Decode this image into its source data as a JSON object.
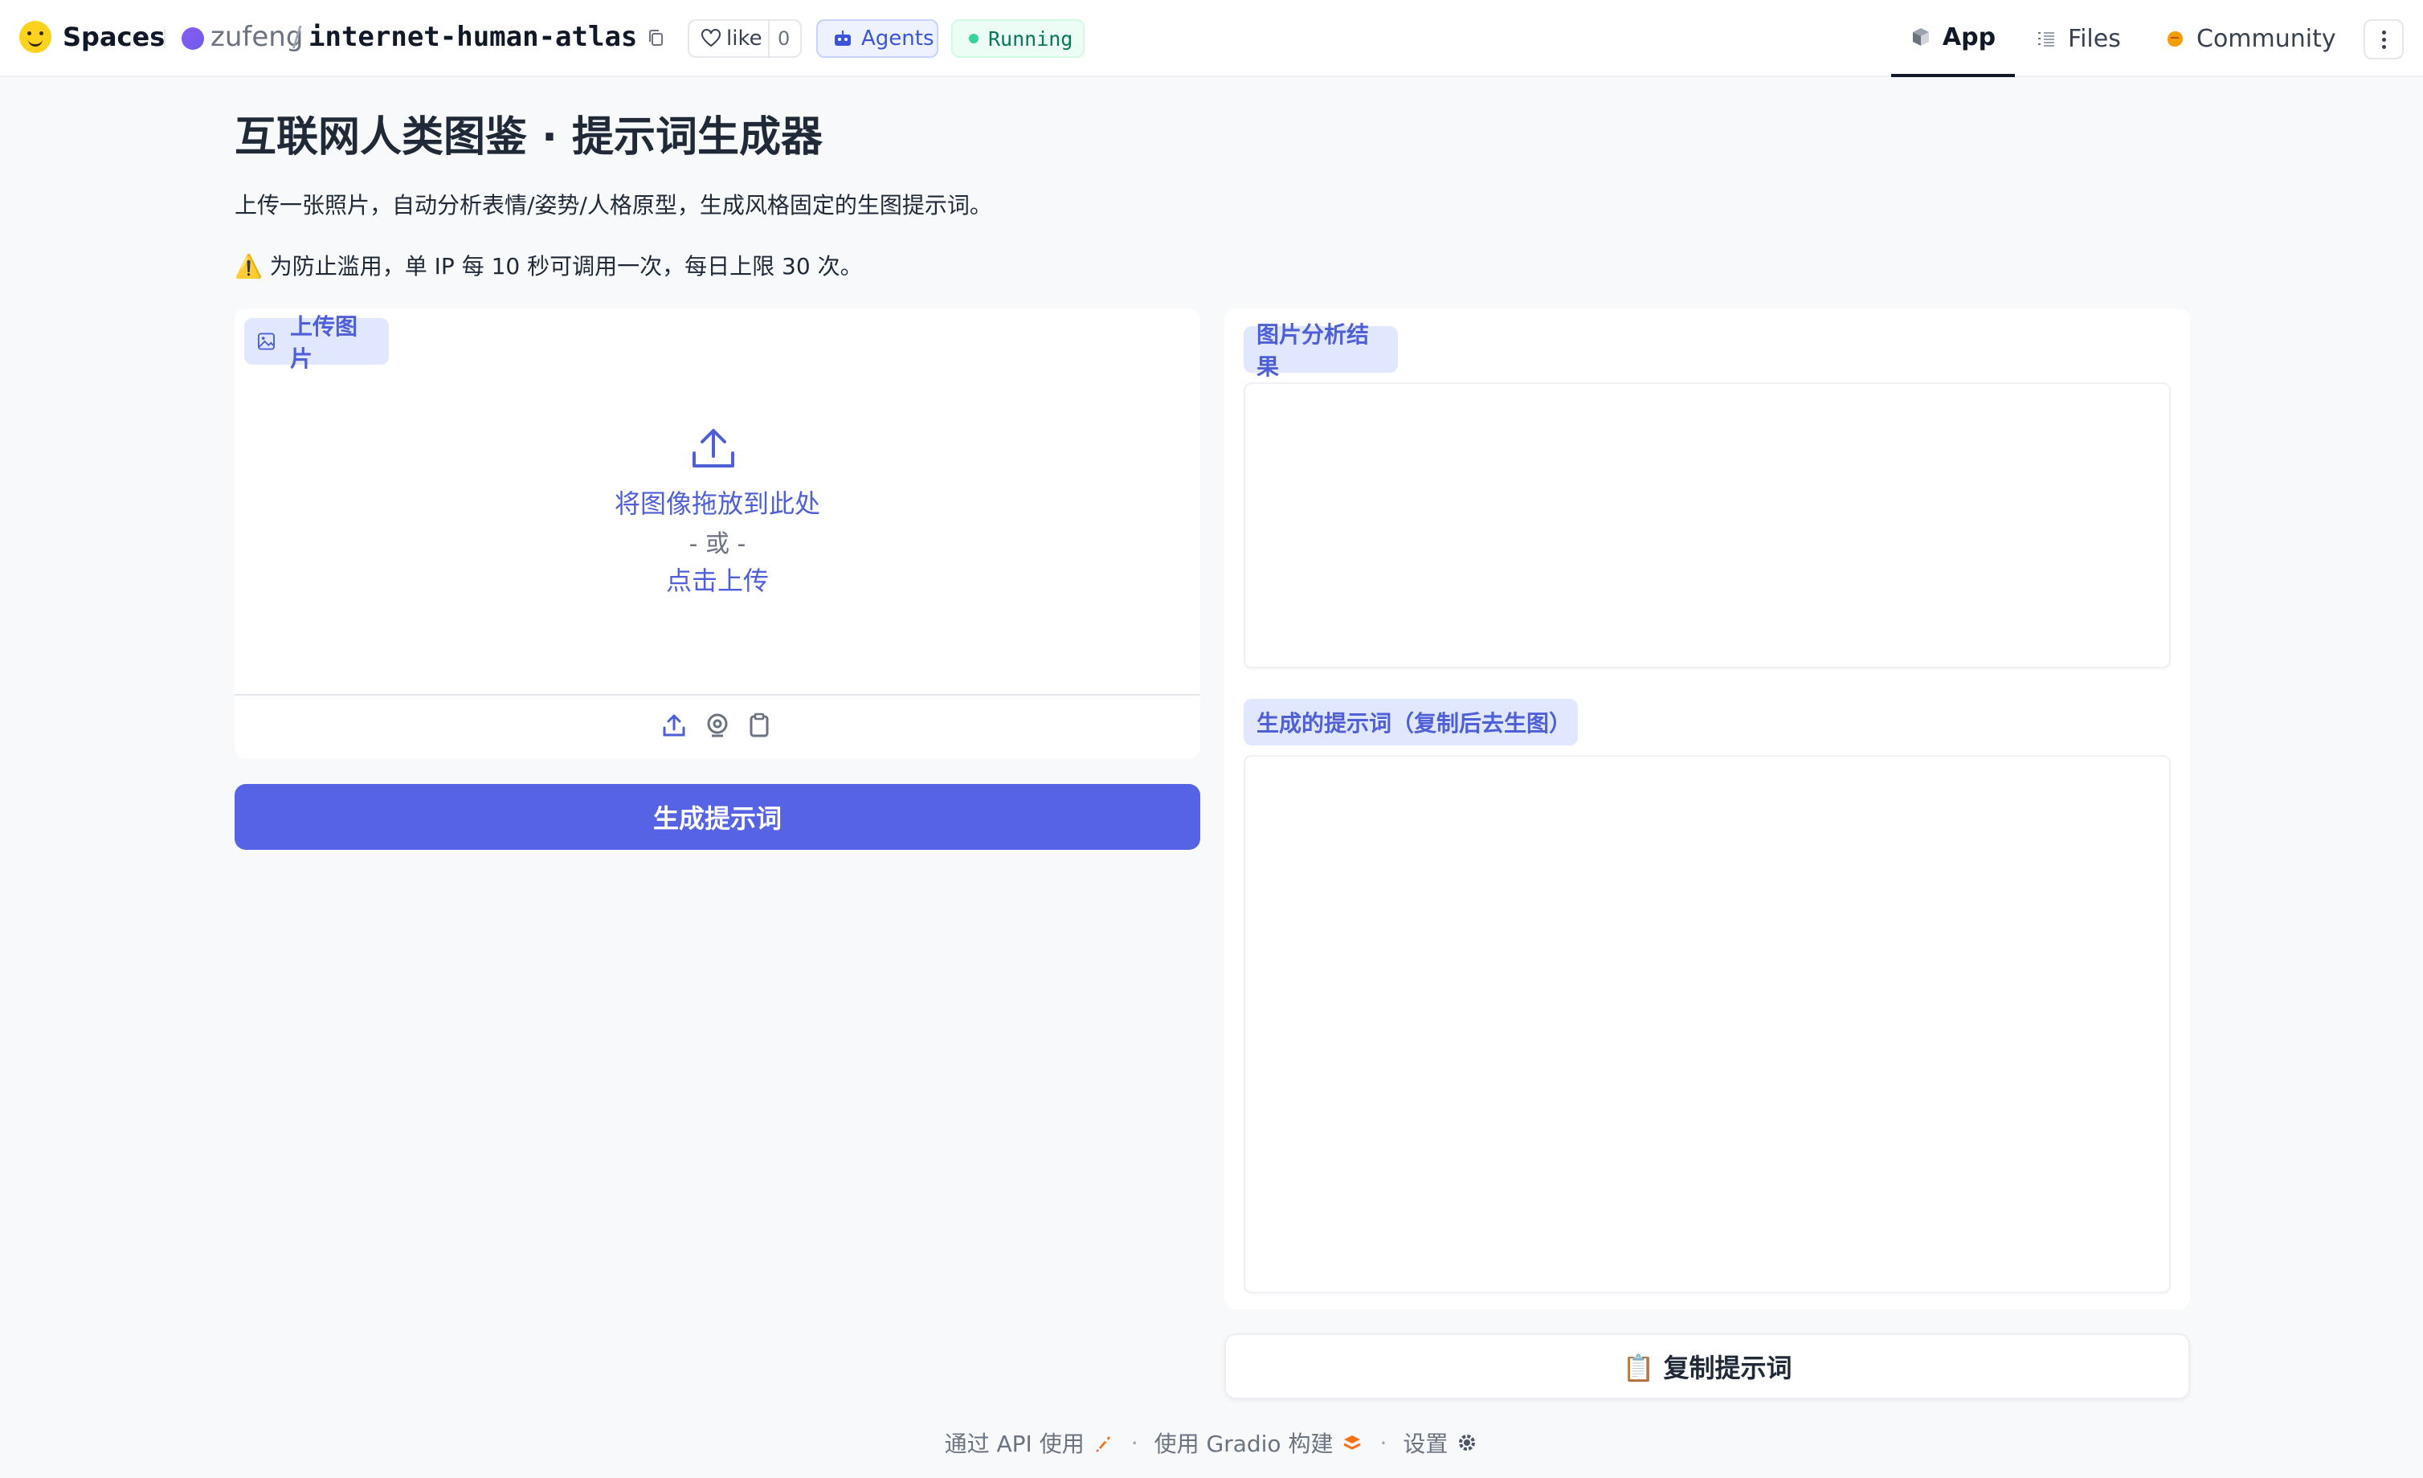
{
  "header": {
    "brand": "Spaces",
    "owner": "zufeng",
    "separator": "/",
    "repo": "internet-human-atlas",
    "like_label": "like",
    "like_count": "0",
    "agents_label": "Agents",
    "status_label": "Running",
    "tabs": [
      {
        "label": "App",
        "icon": "cube-icon",
        "active": true
      },
      {
        "label": "Files",
        "icon": "files-icon",
        "active": false
      },
      {
        "label": "Community",
        "icon": "community-icon",
        "active": false
      }
    ]
  },
  "main": {
    "title": "互联网人类图鉴 · 提示词生成器",
    "description": "上传一张照片，自动分析表情/姿势/人格原型，生成风格固定的生图提示词。",
    "warning": "⚠️ 为防止滥用，单 IP 每 10 秒可调用一次，每日上限 30 次。",
    "upload": {
      "label": "上传图片",
      "drop_text": "将图像拖放到此处",
      "or_text": "- 或 -",
      "click_text": "点击上传"
    },
    "generate_button": "生成提示词",
    "analysis_label": "图片分析结果",
    "analysis_value": "",
    "prompt_label": "生成的提示词（复制后去生图）",
    "prompt_value": "",
    "copy_button": "📋 复制提示词"
  },
  "footer": {
    "api": "通过 API 使用",
    "built": "使用 Gradio 构建",
    "settings": "设置",
    "dot": "·"
  },
  "colors": {
    "accent": "#5563e4",
    "chip_bg": "#e0e7ff",
    "chip_text": "#4f5fd6",
    "running": "#34d399"
  }
}
